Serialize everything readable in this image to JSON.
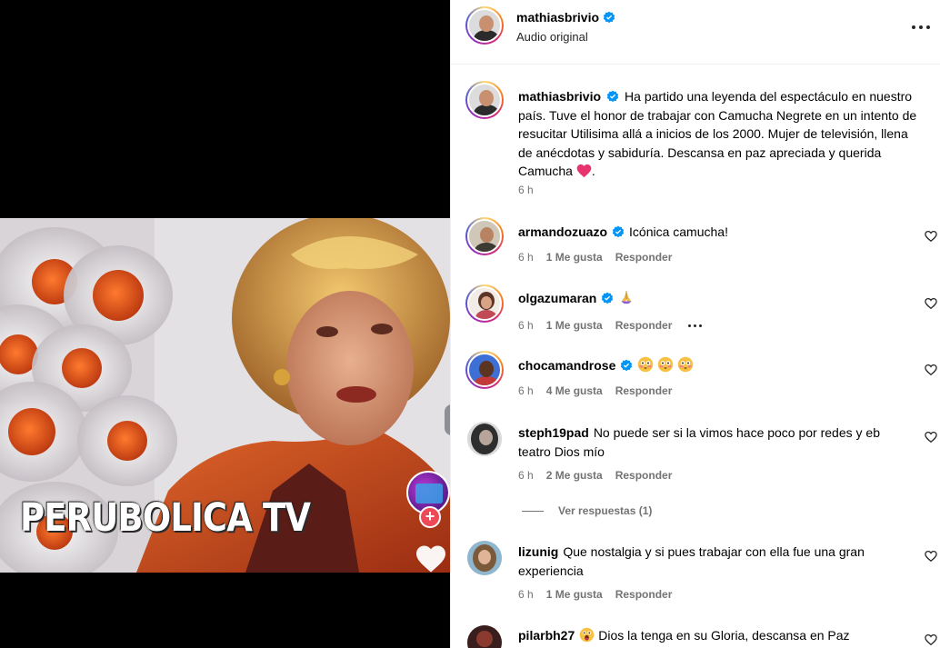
{
  "media": {
    "watermark_text": "PERUBOLICA TV",
    "background_color": "#000000"
  },
  "header": {
    "username": "mathiasbrivio",
    "subtitle": "Audio original",
    "more_icon": "more-options-icon"
  },
  "caption": {
    "username": "mathiasbrivio",
    "text": "Ha partido una leyenda del espectáculo en nuestro país. Tuve el honor de trabajar con Camucha Negrete en un intento de resucitar Utilisima allá a inicios de los 2000. Mujer de televisión, llena de anécdotas y sabiduría. Descansa en paz apreciada y querida Camucha",
    "end_punct": ".",
    "time": "6 h"
  },
  "comments": [
    {
      "username": "armandozuazo",
      "verified": true,
      "text": "Icónica camucha!",
      "time": "6 h",
      "likes": "1 Me gusta",
      "reply": "Responder"
    },
    {
      "username": "olgazumaran",
      "verified": true,
      "text": "",
      "time": "6 h",
      "likes": "1 Me gusta",
      "reply": "Responder"
    },
    {
      "username": "chocamandrose",
      "verified": true,
      "text": "",
      "time": "6 h",
      "likes": "4 Me gusta",
      "reply": "Responder"
    },
    {
      "username": "steph19pad",
      "verified": false,
      "text": "No puede ser si la vimos hace poco por redes y eb teatro Dios mío",
      "time": "6 h",
      "likes": "2 Me gusta",
      "reply": "Responder",
      "view_replies": "Ver respuestas (1)"
    },
    {
      "username": "lizunig",
      "verified": false,
      "text": "Que nostalgia y si pues trabajar con ella fue una gran experiencia",
      "time": "6 h",
      "likes": "1 Me gusta",
      "reply": "Responder"
    },
    {
      "username": "pilarbh27",
      "verified": false,
      "text": "Dios la tenga en su Gloria, descansa en Paz"
    }
  ],
  "colors": {
    "verified_blue": "#0095f6",
    "muted_text": "#737373",
    "heart_pink": "#e8336f"
  }
}
